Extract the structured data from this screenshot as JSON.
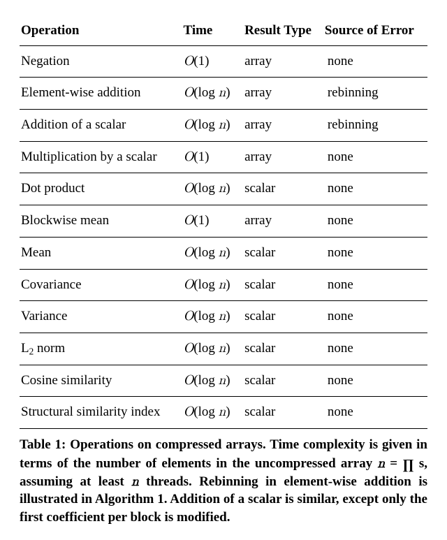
{
  "table": {
    "headers": {
      "operation": "Operation",
      "time": "Time",
      "result_type": "Result Type",
      "source_of_error": "Source of Error"
    },
    "rows": [
      {
        "op": "Negation",
        "time": "O(1)",
        "result": "array",
        "error": "none"
      },
      {
        "op": "Element-wise addition",
        "time": "O(log n)",
        "result": "array",
        "error": "rebinning"
      },
      {
        "op": "Addition of a scalar",
        "time": "O(log n)",
        "result": "array",
        "error": "rebinning"
      },
      {
        "op": "Multiplication by a scalar",
        "time": "O(1)",
        "result": "array",
        "error": "none"
      },
      {
        "op": "Dot product",
        "time": "O(log n)",
        "result": "scalar",
        "error": "none"
      },
      {
        "op": "Blockwise mean",
        "time": "O(1)",
        "result": "array",
        "error": "none"
      },
      {
        "op": "Mean",
        "time": "O(log n)",
        "result": "scalar",
        "error": "none"
      },
      {
        "op": "Covariance",
        "time": "O(log n)",
        "result": "scalar",
        "error": "none"
      },
      {
        "op": "Variance",
        "time": "O(log n)",
        "result": "scalar",
        "error": "none"
      },
      {
        "op": "L2 norm",
        "time": "O(log n)",
        "result": "scalar",
        "error": "none"
      },
      {
        "op": "Cosine similarity",
        "time": "O(log n)",
        "result": "scalar",
        "error": "none"
      },
      {
        "op": "Structural similarity index",
        "time": "O(log n)",
        "result": "scalar",
        "error": "none"
      }
    ]
  },
  "caption": {
    "label": "Table 1:",
    "text_before_n": " Operations on compressed arrays. Time complexity is given in terms of the number of elements in the uncompressed array ",
    "eq_lhs": "n",
    "eq_mid": " = ",
    "eq_rhs_symbol": "∏",
    "eq_rhs_after": " s",
    "text_after_eq": ", assuming at least ",
    "text_n2": "n",
    "text_tail": " threads. Rebinning in element-wise addition is illustrated in Algorithm 1. Addition of a scalar is similar, except only the first coefficient per block is modified."
  }
}
